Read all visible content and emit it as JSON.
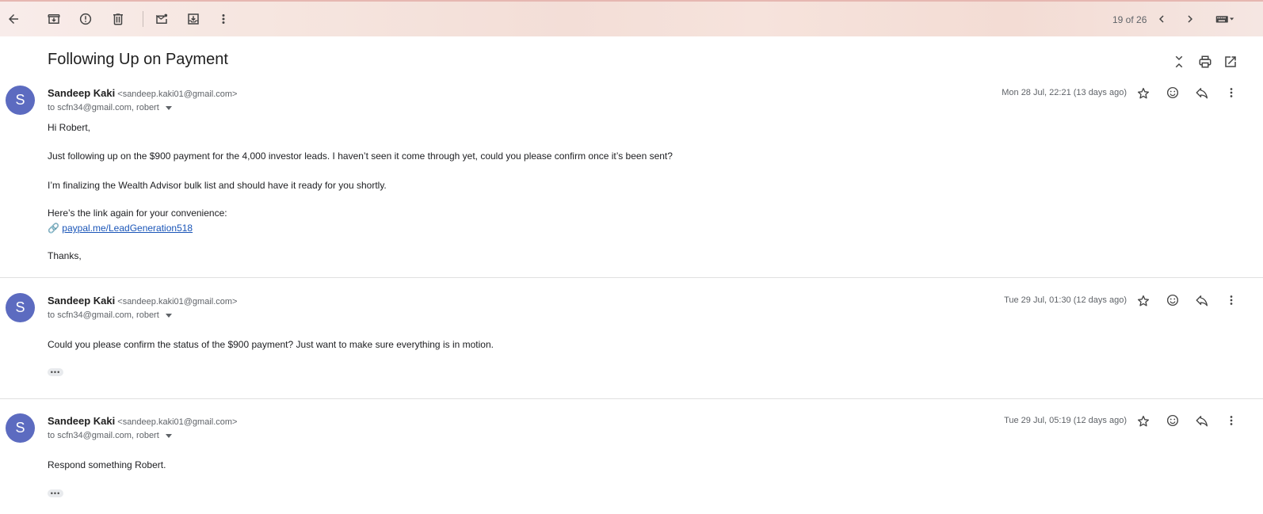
{
  "toolbar": {
    "icons": [
      "back-arrow-icon",
      "archive-icon",
      "report-spam-icon",
      "delete-icon",
      "mark-unread-icon",
      "move-to-icon",
      "more-vert-icon"
    ],
    "pager": "19 of 26"
  },
  "subject": "Following Up on Payment",
  "messages": [
    {
      "avatar": "S",
      "sender_name": "Sandeep Kaki",
      "sender_email": "<sandeep.kaki01@gmail.com>",
      "recipients": "to scfn34@gmail.com, robert",
      "date": "Mon 28 Jul, 22:21 (13 days ago)",
      "body": {
        "greeting": "Hi Robert,",
        "p1": "Just following up on the $900 payment for the 4,000 investor leads. I haven’t seen it come through yet, could you please confirm once it’s been sent?",
        "p2": "I’m finalizing the Wealth Advisor bulk list and should have it ready for you shortly.",
        "p3": "Here’s the link again for your convenience:",
        "link_emoji": "🔗",
        "link": "paypal.me/LeadGeneration518",
        "closing": "Thanks,"
      }
    },
    {
      "avatar": "S",
      "sender_name": "Sandeep Kaki",
      "sender_email": "<sandeep.kaki01@gmail.com>",
      "recipients": "to scfn34@gmail.com, robert",
      "date": "Tue 29 Jul, 01:30 (12 days ago)",
      "body": {
        "p1": "Could you please confirm the status of the $900 payment? Just want to make sure everything is in motion."
      },
      "trimmed": "•••"
    },
    {
      "avatar": "S",
      "sender_name": "Sandeep Kaki",
      "sender_email": "<sandeep.kaki01@gmail.com>",
      "recipients": "to scfn34@gmail.com, robert",
      "date": "Tue 29 Jul, 05:19 (12 days ago)",
      "body": {
        "p1": "Respond something Robert."
      },
      "trimmed": "•••"
    }
  ],
  "colors": {
    "avatar": "#5c6bc0",
    "link": "#1a55b8"
  }
}
